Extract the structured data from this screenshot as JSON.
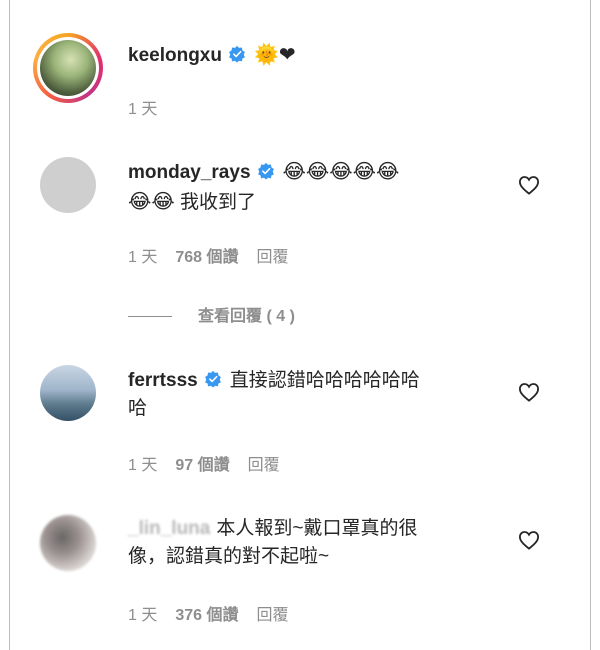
{
  "comments": [
    {
      "username": "keelongxu",
      "verified": true,
      "text": "",
      "emojis": "🌞❤",
      "time": "1 天"
    },
    {
      "username": "monday_rays",
      "verified": true,
      "text": "我收到了",
      "emojis_line1": "😂😂😂😂😂",
      "emojis_line2": "😂😂",
      "time": "1 天",
      "likes": "768 個讚",
      "reply": "回覆",
      "view_replies": "查看回覆 ( 4 )"
    },
    {
      "username": "ferrtsss",
      "verified": true,
      "text": "直接認錯哈哈哈哈哈哈",
      "text_line2": "哈",
      "time": "1 天",
      "likes": "97 個讚",
      "reply": "回覆"
    },
    {
      "username": "_lin_luna",
      "verified": false,
      "text": "本人報到~戴口罩真的很",
      "text_line2": "像，認錯真的對不起啦~",
      "time": "1 天",
      "likes": "376 個讚",
      "reply": "回覆"
    }
  ],
  "icons": {
    "verified_color": "#3897f0",
    "heart_icon": "heart-outline-icon",
    "story_ring_colors": [
      "#f5a623",
      "#e1306c",
      "#c13584"
    ]
  }
}
